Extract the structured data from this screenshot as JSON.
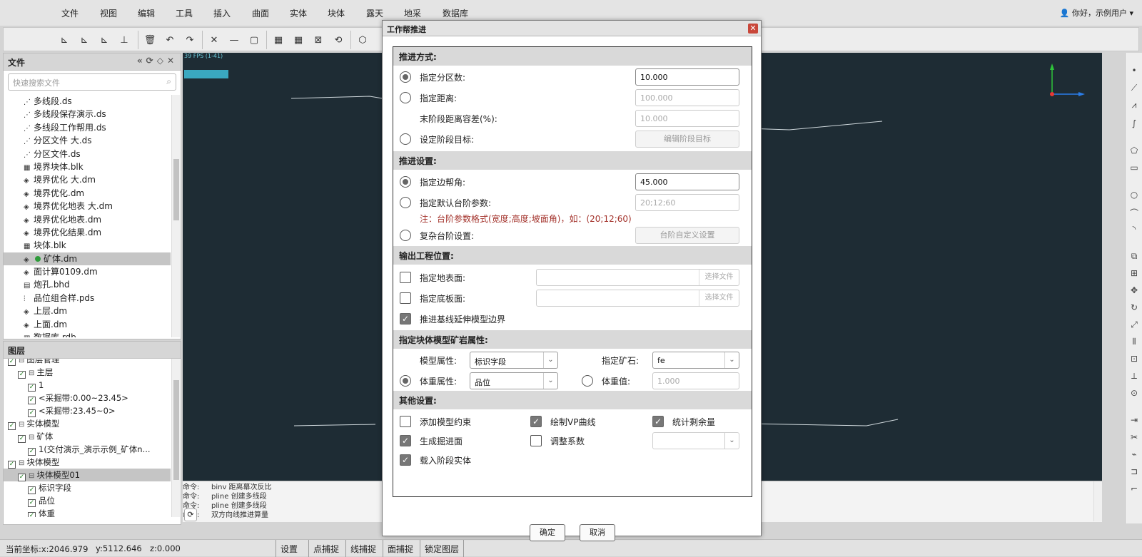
{
  "menu": [
    "文件",
    "视图",
    "编辑",
    "工具",
    "插入",
    "曲面",
    "实体",
    "块体",
    "露天",
    "地采",
    "数据库"
  ],
  "user": "你好，示例用户",
  "files_panel": {
    "title": "文件",
    "search_placeholder": "快速搜索文件",
    "items": [
      {
        "label": "多线段.ds",
        "icon": "polyline-file-icon"
      },
      {
        "label": "多线段保存演示.ds",
        "icon": "polyline-file-icon"
      },
      {
        "label": "多线段工作帮用.ds",
        "icon": "polyline-file-icon"
      },
      {
        "label": "分区文件 大.ds",
        "icon": "polyline-file-icon"
      },
      {
        "label": "分区文件.ds",
        "icon": "polyline-file-icon"
      },
      {
        "label": "境界块体.blk",
        "icon": "block-file-icon"
      },
      {
        "label": "境界优化 大.dm",
        "icon": "solid-file-icon"
      },
      {
        "label": "境界优化.dm",
        "icon": "solid-file-icon"
      },
      {
        "label": "境界优化地表 大.dm",
        "icon": "solid-file-icon"
      },
      {
        "label": "境界优化地表.dm",
        "icon": "solid-file-icon"
      },
      {
        "label": "境界优化结果.dm",
        "icon": "solid-file-icon"
      },
      {
        "label": "块体.blk",
        "icon": "block-file-icon"
      },
      {
        "label": "矿体.dm",
        "icon": "solid-file-icon"
      },
      {
        "label": "面计算0109.dm",
        "icon": "solid-file-icon"
      },
      {
        "label": "炮孔.bhd",
        "icon": "drillhole-file-icon"
      },
      {
        "label": "品位组合样.pds",
        "icon": "sample-file-icon"
      },
      {
        "label": "上层.dm",
        "icon": "solid-file-icon"
      },
      {
        "label": "上面.dm",
        "icon": "solid-file-icon"
      },
      {
        "label": "数据库.rdb",
        "icon": "database-file-icon"
      }
    ],
    "selected_index": 12
  },
  "layers_panel": {
    "title": "图层",
    "items": [
      {
        "label": "图层管理",
        "indent": 0
      },
      {
        "label": "主层",
        "indent": 1
      },
      {
        "label": "1",
        "indent": 2
      },
      {
        "label": "<采掘带:0.00~23.45>",
        "indent": 2
      },
      {
        "label": "<采掘带:23.45~0>",
        "indent": 2
      },
      {
        "label": "实体模型",
        "indent": 0
      },
      {
        "label": "矿体",
        "indent": 1
      },
      {
        "label": "1(交付演示_演示示例_矿体n...",
        "indent": 2
      },
      {
        "label": "块体模型",
        "indent": 0
      },
      {
        "label": "块体模型01",
        "indent": 1
      },
      {
        "label": "标识字段",
        "indent": 2
      },
      {
        "label": "品位",
        "indent": 2
      },
      {
        "label": "体重",
        "indent": 2
      }
    ],
    "selected_index": 9
  },
  "viewport": {
    "fps": "39 FPS (1-41)"
  },
  "commands": [
    {
      "key": "命令:",
      "text": "binv 距离幕次反比"
    },
    {
      "key": "命令:",
      "text": "pline 创建多线段"
    },
    {
      "key": "命令:",
      "text": "pline 创建多线段"
    },
    {
      "key": "命令:",
      "text": "双方向线推进算量"
    }
  ],
  "status": {
    "x": "当前坐标:x:2046.979",
    "y": "y:5112.646",
    "z": "z:0.000",
    "buttons": [
      "设置",
      "点捕捉",
      "线捕捉",
      "面捕捉",
      "锁定图层"
    ]
  },
  "dialog": {
    "title": "工作帮推进",
    "sec_advance": "推进方式:",
    "opt_partitions": "指定分区数:",
    "partitions_value": "10.000",
    "opt_distance": "指定距离:",
    "distance_value": "100.000",
    "tolerance_label": "末阶段距离容差(%):",
    "tolerance_value": "10.000",
    "opt_stage_target": "设定阶段目标:",
    "edit_stage_btn": "编辑阶段目标",
    "sec_settings": "推进设置:",
    "opt_slope": "指定边帮角:",
    "slope_value": "45.000",
    "opt_bench": "指定默认台阶参数:",
    "bench_value": "20;12;60",
    "bench_note": "注：台阶参数格式(宽度;高度;坡面角)，如：(20;12;60)",
    "opt_complex": "复杂台阶设置:",
    "custom_bench_btn": "台阶自定义设置",
    "sec_output": "输出工程位置:",
    "surface_label": "指定地表面:",
    "floor_label": "指定底板面:",
    "select_file": "选择文件",
    "extend_label": "推进基线延伸模型边界",
    "sec_block": "指定块体模型矿岩属性:",
    "model_attr_label": "模型属性:",
    "model_attr_value": "标识字段",
    "ore_label": "指定矿石:",
    "ore_value": "fe",
    "density_attr_label": "体重属性:",
    "density_attr_value": "品位",
    "density_value_label": "体重值:",
    "density_value": "1.000",
    "sec_other": "其他设置:",
    "add_constraint": "添加模型约束",
    "draw_vp": "绘制VP曲线",
    "stat_remaining": "统计剩余量",
    "gen_face": "生成掘进面",
    "adjust_coef": "调整系数",
    "load_stage": "载入阶段实体",
    "ok": "确定",
    "cancel": "取消"
  },
  "colors": {
    "viewport_bg": "#1e2c34",
    "accent_note": "#a3322b"
  }
}
